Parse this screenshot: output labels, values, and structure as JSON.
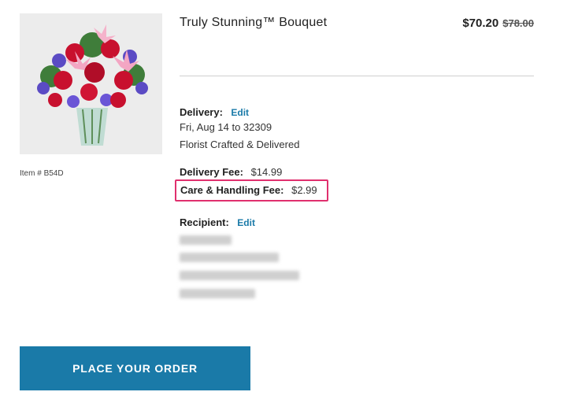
{
  "product": {
    "title": "Truly Stunning™ Bouquet",
    "price_sale": "$70.20",
    "price_original": "$78.00",
    "item_number": "Item # B54D"
  },
  "delivery": {
    "label": "Delivery:",
    "edit_label": "Edit",
    "date": "Fri, Aug 14 to 32309",
    "method": "Florist Crafted & Delivered"
  },
  "fees": {
    "delivery_label": "Delivery Fee:",
    "delivery_value": "$14.99",
    "care_label": "Care & Handling Fee:",
    "care_value": "$2.99"
  },
  "recipient": {
    "label": "Recipient:",
    "edit_label": "Edit"
  },
  "actions": {
    "place_order_label": "PLACE YOUR ORDER"
  },
  "colors": {
    "accent": "#1a7aa8",
    "highlight": "#e0306e"
  }
}
